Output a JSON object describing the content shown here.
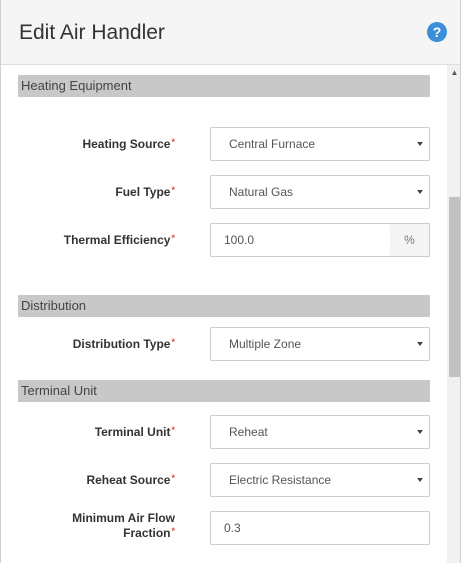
{
  "dialog": {
    "title": "Edit Air Handler",
    "help_icon": "question-circle-icon",
    "help_glyph": "?"
  },
  "sections": {
    "heating": {
      "title": "Heating Equipment"
    },
    "distribution": {
      "title": "Distribution"
    },
    "terminal": {
      "title": "Terminal Unit"
    }
  },
  "fields": {
    "heating_source": {
      "label": "Heating Source",
      "value": "Central Furnace"
    },
    "fuel_type": {
      "label": "Fuel Type",
      "value": "Natural Gas"
    },
    "thermal_efficiency": {
      "label": "Thermal Efficiency",
      "value": "100.0",
      "unit": "%"
    },
    "distribution_type": {
      "label": "Distribution Type",
      "value": "Multiple Zone"
    },
    "terminal_unit": {
      "label": "Terminal Unit",
      "value": "Reheat"
    },
    "reheat_source": {
      "label": "Reheat Source",
      "value": "Electric Resistance"
    },
    "min_air_flow": {
      "label_line1": "Minimum Air Flow",
      "label_line2": "Fraction",
      "value": "0.3"
    }
  },
  "required_marker": "*",
  "colors": {
    "section_bar": "#c8c8c8",
    "required": "#d9534f",
    "help_icon": "#3b8fd9"
  }
}
